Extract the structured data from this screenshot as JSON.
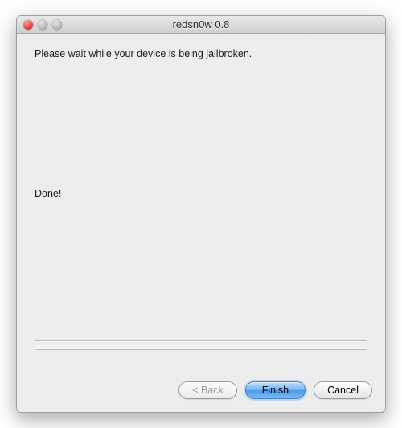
{
  "window": {
    "title": "redsn0w 0.8"
  },
  "content": {
    "instruction": "Please wait while your device is being jailbroken.",
    "status": "Done!"
  },
  "buttons": {
    "back": "< Back",
    "finish": "Finish",
    "cancel": "Cancel"
  }
}
